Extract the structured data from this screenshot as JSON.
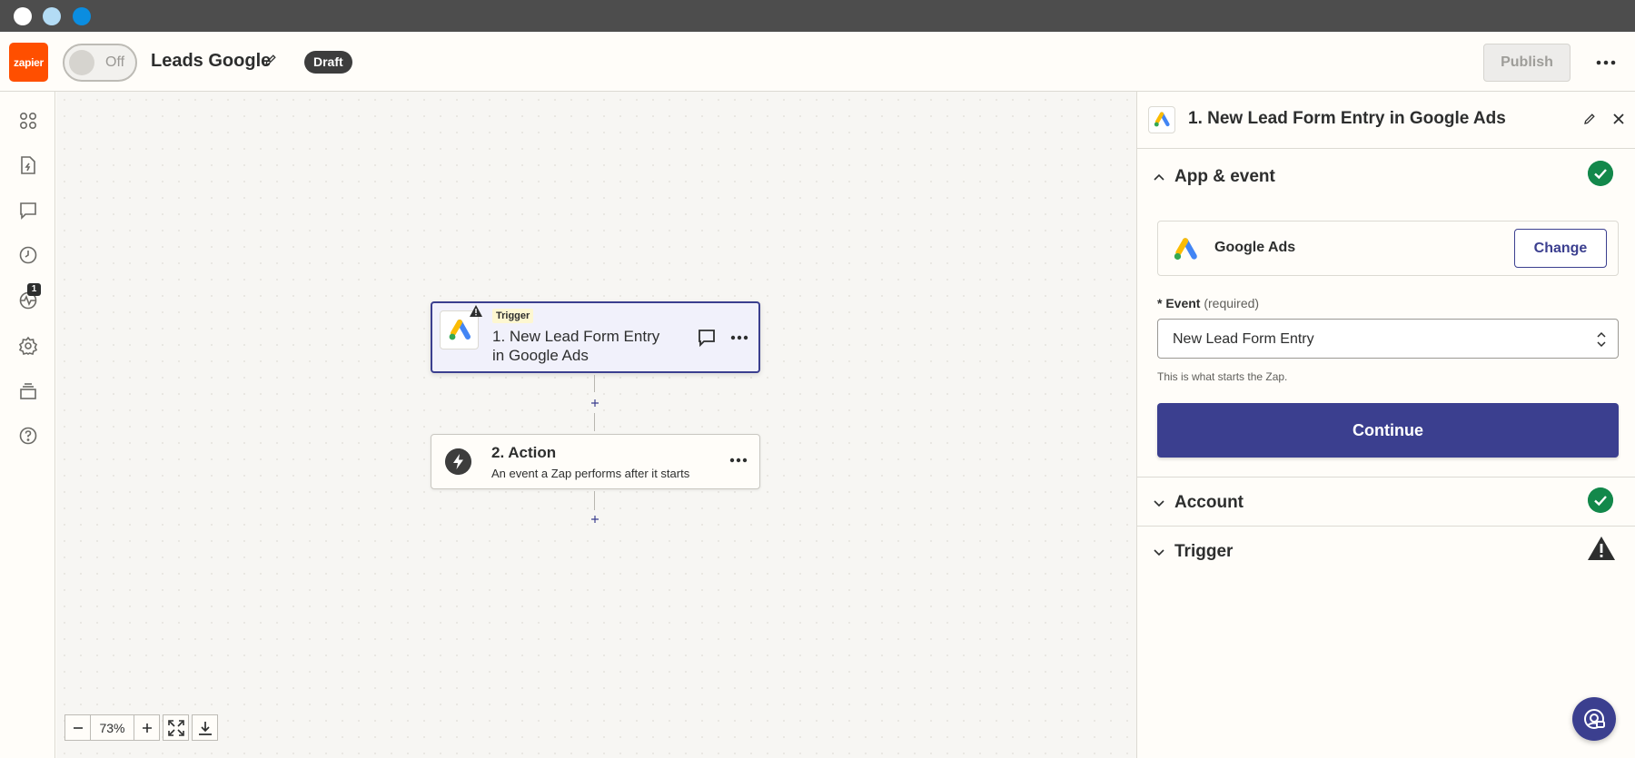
{
  "window": {
    "buttons": [
      "close",
      "minimize",
      "maximize"
    ]
  },
  "header": {
    "logo_text": "zapier",
    "toggle_label": "Off",
    "zap_title": "Leads Google",
    "status_badge": "Draft",
    "publish_label": "Publish"
  },
  "sidebar": {
    "items": [
      {
        "icon": "apps-icon"
      },
      {
        "icon": "file-lightning-icon"
      },
      {
        "icon": "comment-icon"
      },
      {
        "icon": "history-icon"
      },
      {
        "icon": "activity-icon",
        "badge": "1"
      },
      {
        "icon": "settings-icon"
      },
      {
        "icon": "versions-icon"
      },
      {
        "icon": "help-icon"
      }
    ]
  },
  "canvas": {
    "step1": {
      "tag": "Trigger",
      "title": "1. New Lead Form Entry in Google Ads"
    },
    "step2": {
      "title": "2. Action",
      "subtitle": "An event a Zap performs after it starts"
    },
    "zoom": {
      "value": "73%"
    }
  },
  "panel": {
    "title": "1. New Lead Form Entry in Google Ads",
    "sections": {
      "app_event": {
        "label": "App & event",
        "status": "complete"
      },
      "account": {
        "label": "Account",
        "status": "complete"
      },
      "trigger": {
        "label": "Trigger",
        "status": "warning"
      }
    },
    "app": {
      "name": "Google Ads",
      "change_label": "Change"
    },
    "event": {
      "asterisk": "*",
      "label": "Event",
      "required": "(required)",
      "value": "New Lead Form Entry",
      "help": "This is what starts the Zap."
    },
    "continue_label": "Continue"
  },
  "colors": {
    "brand_orange": "#ff4f00",
    "primary": "#3b3f8f",
    "success": "#13884b"
  }
}
